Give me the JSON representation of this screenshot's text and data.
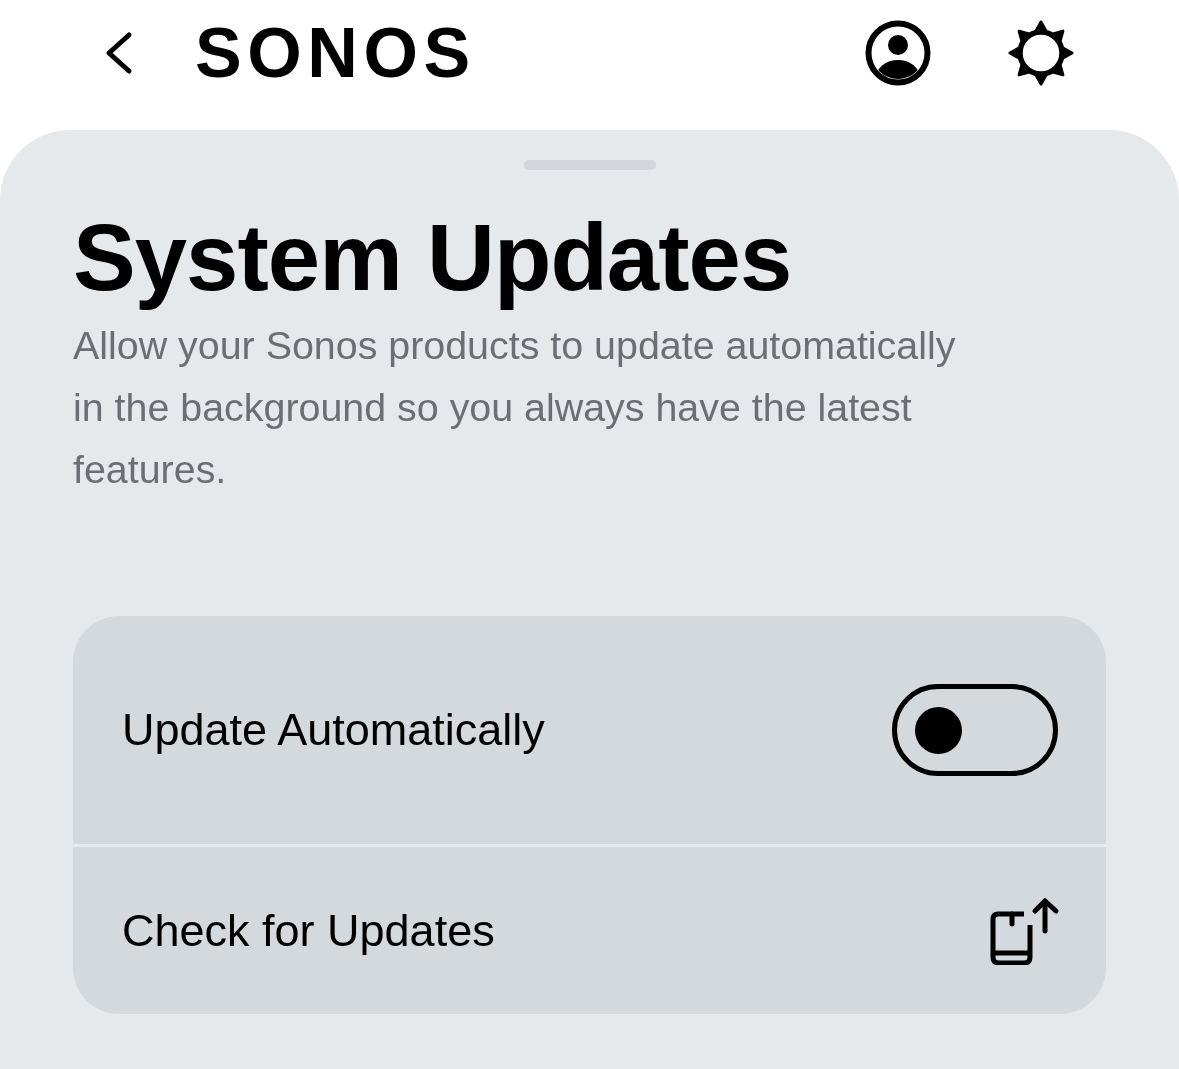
{
  "header": {
    "logo": "SONOS"
  },
  "sheet": {
    "title": "System Updates",
    "description": "Allow your Sonos products to update automatically in the background so you always have the latest features."
  },
  "settings": [
    {
      "kind": "toggle",
      "label": "Update Automatically",
      "on": false
    },
    {
      "kind": "action",
      "label": "Check for Updates"
    }
  ]
}
